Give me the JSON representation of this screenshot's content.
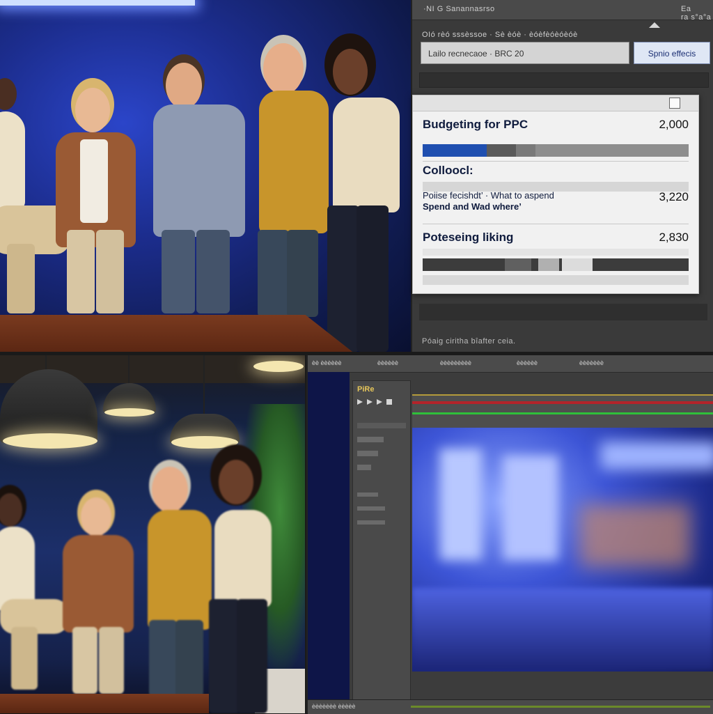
{
  "top_panel": {
    "menu_title": "·NI G Sanannasrso",
    "menu_right": "Ea ra s°a°a",
    "subtitle_row": "OIó rèó sssèssoe  · Sè èóè  · èóèfèóèóèóè",
    "field_value": "Lailo recnecaoe  ·  BRC 20",
    "button_label": "Spnio effecis",
    "footer_text": "Póaig ciritha bîafter ceia.",
    "card": {
      "row1_title": "Budgeting for PPC",
      "row1_value": "2,000",
      "row1_progress": 0.35,
      "row2_title": "Colloocl:",
      "row3_line1": "Poiise fecishdt’  · What to aspend",
      "row3_line2": "Spend and Wad where’",
      "row3_value": "3,220",
      "row4_title": "Poteseing liking",
      "row4_value": "2,830"
    }
  },
  "editor": {
    "topbar_labels": [
      "èè èèèèèè",
      "èèèèèè",
      "èèèèèèèèè",
      "èèèèèè",
      "èèèèèèè"
    ],
    "panel_title": "PiRe",
    "status_left": "èèèèèèè  èèèèè"
  },
  "colors": {
    "accent_blue": "#1f4fb0",
    "studio_blue": "#1c2d8e",
    "timeline_red": "#b3242a",
    "status_green": "#2fbf3a"
  },
  "icons": [
    "window-close-icon",
    "collapse-triangle-icon",
    "play-controls-icon"
  ]
}
